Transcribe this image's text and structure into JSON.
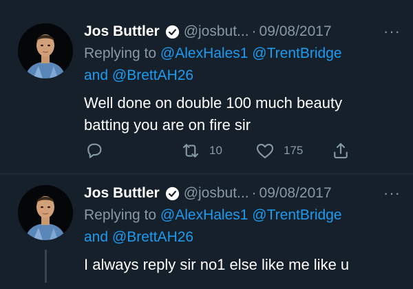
{
  "tweets": [
    {
      "name": "Jos Buttler",
      "handle": "@josbut...",
      "separator": "·",
      "date": "09/08/2017",
      "more": "···",
      "replying_prefix": "Replying to",
      "mention_1": "@AlexHales1",
      "mention_2": "@TrentBridge",
      "and_text": "and",
      "mention_3": "@BrettAH26",
      "text_line_1": "Well done on double 100 much beauty",
      "text_line_2": "batting you are on fire sir",
      "retweet_count": "10",
      "like_count": "175"
    },
    {
      "name": "Jos Buttler",
      "handle": "@josbut...",
      "separator": "·",
      "date": "09/08/2017",
      "more": "···",
      "replying_prefix": "Replying to",
      "mention_1": "@AlexHales1",
      "mention_2": "@TrentBridge",
      "and_text": "and",
      "mention_3": "@BrettAH26",
      "text_line_1": "I always reply sir no1 else like me like u"
    }
  ],
  "icons": {
    "verified": "verified-badge-icon",
    "reply": "reply-icon",
    "retweet": "retweet-icon",
    "like": "heart-icon",
    "share": "share-icon",
    "more": "more-options-icon"
  },
  "colors": {
    "background": "#15202b",
    "text": "#ffffff",
    "secondary": "#8899a6",
    "link": "#1d9bf0",
    "divider": "#263340"
  }
}
